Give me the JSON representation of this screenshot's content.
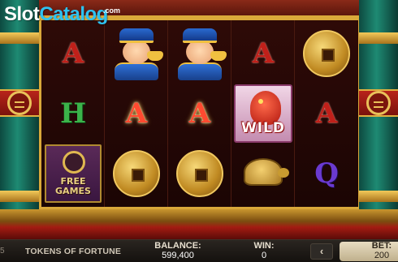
{
  "watermark": {
    "part1": "Slot",
    "part2": "Catalog",
    "domain": ".com"
  },
  "reels": [
    {
      "symbols": [
        "A",
        "H",
        "free-games"
      ]
    },
    {
      "symbols": [
        "fortune-god",
        "A",
        "coin"
      ]
    },
    {
      "symbols": [
        "fortune-god",
        "A",
        "coin"
      ]
    },
    {
      "symbols": [
        "A",
        "wild",
        "golden-turtle"
      ]
    },
    {
      "symbols": [
        "coin",
        "A",
        "Q"
      ]
    }
  ],
  "symbols": {
    "wild_label": "WILD",
    "free_games_label": "FREE GAMES"
  },
  "bottom_bar": {
    "index_text": "5",
    "game_name": "TOKENS OF FORTUNE",
    "balance_label": "BALANCE:",
    "balance_value": "599,400",
    "win_label": "WIN:",
    "win_value": "0",
    "prev_arrow": "‹",
    "bet_label": "BET:",
    "bet_value": "200"
  },
  "colors": {
    "gold": "#d9a83a",
    "pillar": "#1e8a73",
    "accent_blue": "#2ec2f0"
  }
}
